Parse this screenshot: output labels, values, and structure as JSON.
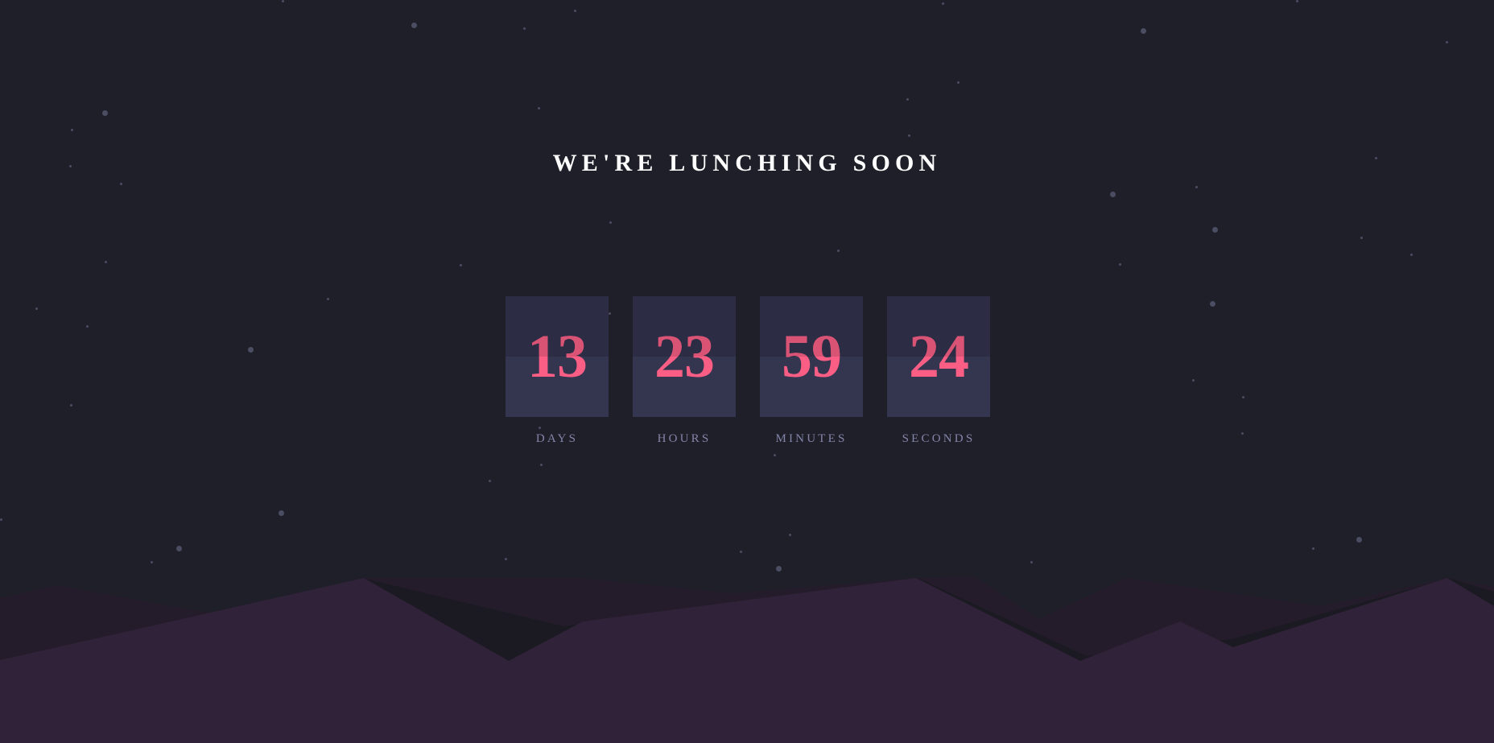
{
  "page": {
    "title": "WE'RE LUNCHING SOON"
  },
  "countdown": [
    {
      "value": "13",
      "label": "DAYS"
    },
    {
      "value": "23",
      "label": "HOURS"
    },
    {
      "value": "59",
      "label": "MINUTES"
    },
    {
      "value": "24",
      "label": "SECONDS"
    }
  ],
  "colors": {
    "background": "#1f1f29",
    "card": "#343650",
    "card_top": "#2c2c44",
    "digits": "#fb5e84",
    "label": "#8385a9",
    "title": "#ffffff",
    "hill_front": "#302238",
    "hill_back": "#241c2b",
    "star": "#4b4d63"
  }
}
